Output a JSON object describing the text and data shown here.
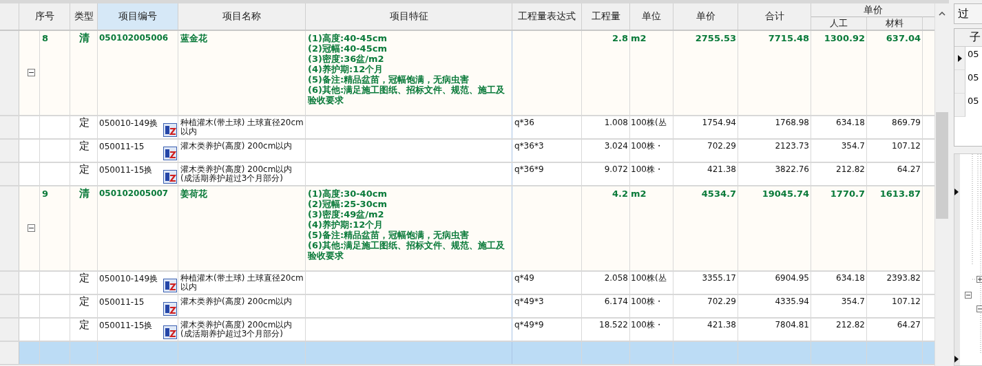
{
  "table": {
    "columns": [
      {
        "label": "序号",
        "selected": false
      },
      {
        "label": "类型",
        "selected": false
      },
      {
        "label": "项目编号",
        "selected": true
      },
      {
        "label": "项目名称",
        "selected": false
      },
      {
        "label": "项目特征",
        "selected": false
      },
      {
        "label": "工程量表达式",
        "selected": false
      },
      {
        "label": "工程量",
        "selected": false
      },
      {
        "label": "单位",
        "selected": false
      },
      {
        "label": "单价",
        "selected": false
      },
      {
        "label": "合计",
        "selected": false
      }
    ],
    "column_group": {
      "label": "单价",
      "children": [
        "人工",
        "材料"
      ]
    },
    "rows": [
      {
        "kind": "bill",
        "selected": false,
        "expanded": true,
        "seq": "8",
        "type": "清",
        "code": "050102005006",
        "name": "蓝金花",
        "features": [
          "(1)高度:40-45cm",
          "(2)冠幅:40-45cm",
          "(3)密度:36盆/m2",
          "(4)养护期:12个月",
          "(5)备注:精品盆苗，冠幅饱满，无病虫害",
          "(6)其他:满足施工图纸、招标文件、规范、施工及验收要求"
        ],
        "qty": "2.8",
        "unit": "m2",
        "price": "2755.53",
        "total": "7715.48",
        "labor": "1300.92",
        "material": "637.04"
      },
      {
        "kind": "quota",
        "selected": false,
        "type": "定",
        "code": "050010-149换",
        "name": "种植灌木(带土球) 土球直径20cm以内",
        "expr": "q*36",
        "qty": "1.008",
        "unit": "100株(丛",
        "price": "1754.94",
        "total": "1768.98",
        "labor": "634.18",
        "material": "869.79"
      },
      {
        "kind": "quota",
        "selected": false,
        "type": "定",
        "code": "050011-15",
        "name": "灌木类养护(高度) 200cm以内",
        "expr": "q*36*3",
        "qty": "3.024",
        "unit": "100株・",
        "price": "702.29",
        "total": "2123.73",
        "labor": "354.7",
        "material": "107.12"
      },
      {
        "kind": "quota",
        "selected": false,
        "type": "定",
        "code": "050011-15换",
        "name": "灌木类养护(高度) 200cm以内(成活期养护超过3个月部分)",
        "expr": "q*36*9",
        "qty": "9.072",
        "unit": "100株・",
        "price": "421.38",
        "total": "3822.76",
        "labor": "212.82",
        "material": "64.27"
      },
      {
        "kind": "bill",
        "selected": false,
        "expanded": true,
        "seq": "9",
        "type": "清",
        "code": "050102005007",
        "name": "姜荷花",
        "features": [
          "(1)高度:30-40cm",
          "(2)冠幅:25-30cm",
          "(3)密度:49盆/m2",
          "(4)养护期:12个月",
          "(5)备注:精品盆苗，冠幅饱满，无病虫害",
          "(6)其他:满足施工图纸、招标文件、规范、施工及验收要求"
        ],
        "qty": "4.2",
        "unit": "m2",
        "price": "4534.7",
        "total": "19045.74",
        "labor": "1770.7",
        "material": "1613.87"
      },
      {
        "kind": "quota",
        "selected": false,
        "type": "定",
        "code": "050010-149换",
        "name": "种植灌木(带土球) 土球直径20cm以内",
        "expr": "q*49",
        "qty": "2.058",
        "unit": "100株(丛",
        "price": "3355.17",
        "total": "6904.95",
        "labor": "634.18",
        "material": "2393.82"
      },
      {
        "kind": "quota",
        "selected": false,
        "type": "定",
        "code": "050011-15",
        "name": "灌木类养护(高度) 200cm以内",
        "expr": "q*49*3",
        "qty": "6.174",
        "unit": "100株・",
        "price": "702.29",
        "total": "4335.94",
        "labor": "354.7",
        "material": "107.12"
      },
      {
        "kind": "quota",
        "selected": false,
        "type": "定",
        "code": "050011-15换",
        "name": "灌木类养护(高度) 200cm以内(成活期养护超过3个月部分)",
        "expr": "q*49*9",
        "qty": "18.522",
        "unit": "100株・",
        "price": "421.38",
        "total": "7804.81",
        "labor": "212.82",
        "material": "64.27"
      },
      {
        "kind": "blank",
        "selected": true
      }
    ]
  },
  "side_panel": {
    "tab": "过",
    "grid_header": "子",
    "grid_rows": [
      {
        "text": "05",
        "selected": true
      },
      {
        "text": "05",
        "selected": false
      },
      {
        "text": "05",
        "selected": false
      }
    ]
  }
}
